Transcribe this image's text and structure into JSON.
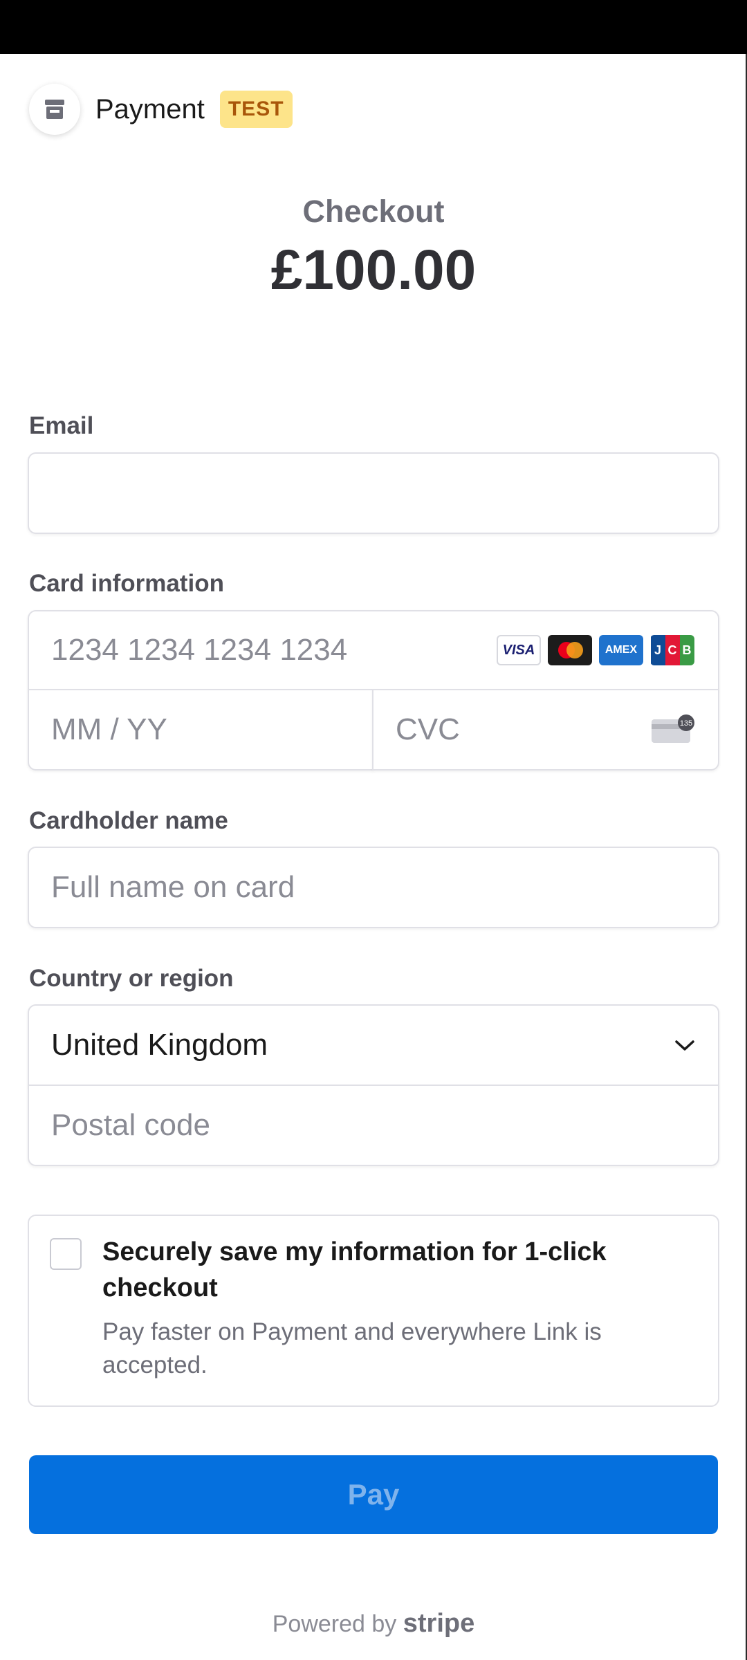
{
  "header": {
    "merchant_name": "Payment",
    "test_badge": "TEST"
  },
  "summary": {
    "title": "Checkout",
    "amount": "£100.00"
  },
  "email": {
    "label": "Email",
    "value": ""
  },
  "card": {
    "label": "Card information",
    "number_placeholder": "1234 1234 1234 1234",
    "expiry_placeholder": "MM / YY",
    "cvc_placeholder": "CVC",
    "brands": [
      "VISA",
      "AMEX",
      "JCB"
    ],
    "cvc_hint": "135"
  },
  "cardholder": {
    "label": "Cardholder name",
    "placeholder": "Full name on card"
  },
  "country": {
    "label": "Country or region",
    "selected": "United Kingdom",
    "postal_placeholder": "Postal code"
  },
  "save_info": {
    "title": "Securely save my information for 1-click checkout",
    "subtitle": "Pay faster on Payment and everywhere Link is accepted.",
    "checked": false
  },
  "pay_button": {
    "label": "Pay"
  },
  "footer": {
    "prefix": "Powered by",
    "brand": "stripe"
  },
  "colors": {
    "accent": "#0570de",
    "badge_bg": "#fde48a",
    "badge_text": "#a8560a"
  }
}
